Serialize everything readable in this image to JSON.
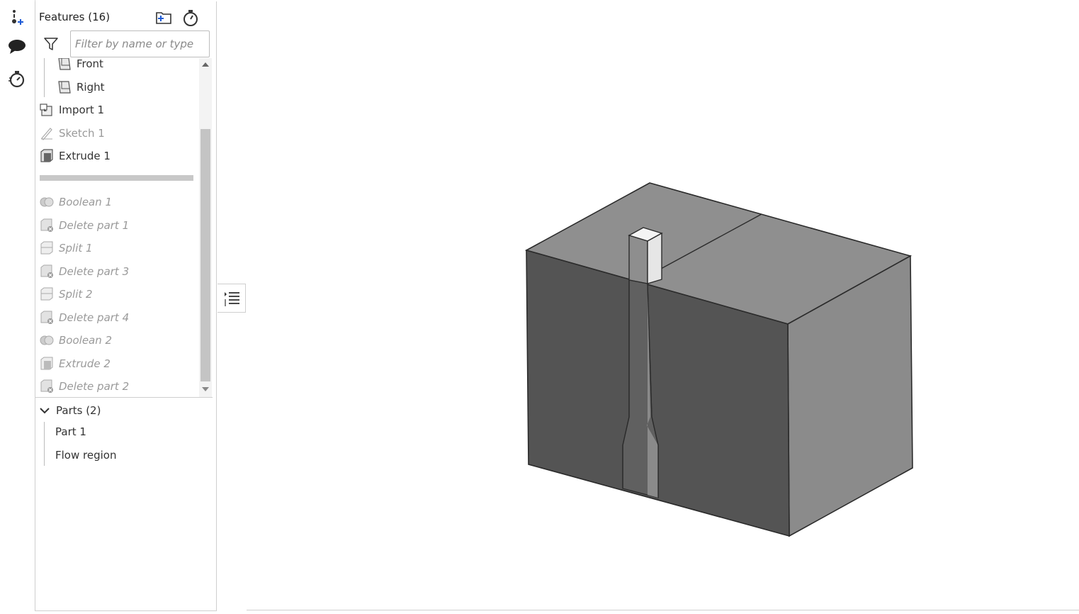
{
  "rail": {
    "icons": [
      "insert-feature-icon",
      "comment-icon",
      "timer-icon"
    ]
  },
  "panel": {
    "title": "Features (16)",
    "header_icons": [
      "add-folder-icon",
      "rollback-timer-icon"
    ],
    "filter_placeholder": "Filter by name or type"
  },
  "features": [
    {
      "label": "Front",
      "icon": "plane-icon",
      "state": "normal"
    },
    {
      "label": "Right",
      "icon": "plane-icon",
      "state": "normal"
    },
    {
      "label": "Import 1",
      "icon": "import-icon",
      "state": "normal"
    },
    {
      "label": "Sketch 1",
      "icon": "sketch-icon",
      "state": "dim"
    },
    {
      "label": "Extrude 1",
      "icon": "extrude-icon",
      "state": "normal"
    },
    {
      "label": "Boolean 1",
      "icon": "boolean-icon",
      "state": "rolled-back"
    },
    {
      "label": "Delete part 1",
      "icon": "delete-part-icon",
      "state": "rolled-back"
    },
    {
      "label": "Split 1",
      "icon": "split-icon",
      "state": "rolled-back"
    },
    {
      "label": "Delete part 3",
      "icon": "delete-part-icon",
      "state": "rolled-back"
    },
    {
      "label": "Split 2",
      "icon": "split-icon",
      "state": "rolled-back"
    },
    {
      "label": "Delete part 4",
      "icon": "delete-part-icon",
      "state": "rolled-back"
    },
    {
      "label": "Boolean 2",
      "icon": "boolean-icon",
      "state": "rolled-back"
    },
    {
      "label": "Extrude 2",
      "icon": "extrude-icon",
      "state": "rolled-back"
    },
    {
      "label": "Delete part 2",
      "icon": "delete-part-icon",
      "state": "rolled-back"
    }
  ],
  "parts": {
    "title": "Parts (2)",
    "items": [
      "Part 1",
      "Flow region"
    ]
  },
  "colors": {
    "model_front": "#545454",
    "model_top": "#8e8e8e",
    "model_side": "#8a8a8a",
    "accent_blue": "#1e5bd6"
  }
}
